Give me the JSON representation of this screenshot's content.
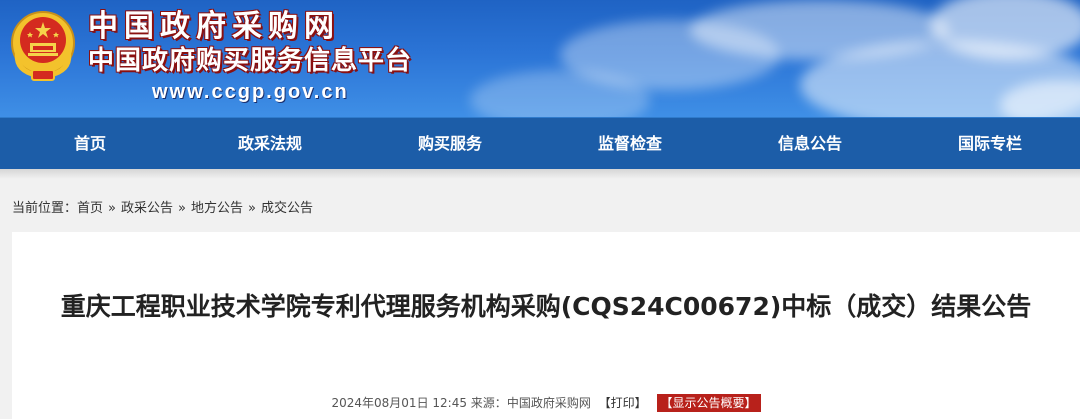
{
  "header": {
    "title": "中国政府采购网",
    "subtitle": "中国政府购买服务信息平台",
    "url": "www.ccgp.gov.cn"
  },
  "nav": {
    "items": [
      {
        "label": "首页"
      },
      {
        "label": "政采法规"
      },
      {
        "label": "购买服务"
      },
      {
        "label": "监督检查"
      },
      {
        "label": "信息公告"
      },
      {
        "label": "国际专栏"
      }
    ]
  },
  "breadcrumb": {
    "prefix": "当前位置：",
    "items": [
      "首页",
      "政采公告",
      "地方公告",
      "成交公告"
    ],
    "separator": "»"
  },
  "article": {
    "title": "重庆工程职业技术学院专利代理服务机构采购(CQS24C00672)中标（成交）结果公告",
    "datetime": "2024年08月01日 12:45",
    "source_label": "来源：",
    "source": "中国政府采购网",
    "print_label": "【打印】",
    "summary_label": "【显示公告概要】"
  },
  "colors": {
    "banner": "#2b74d6",
    "nav": "#1c5da8",
    "summary_button": "#b8211b"
  }
}
